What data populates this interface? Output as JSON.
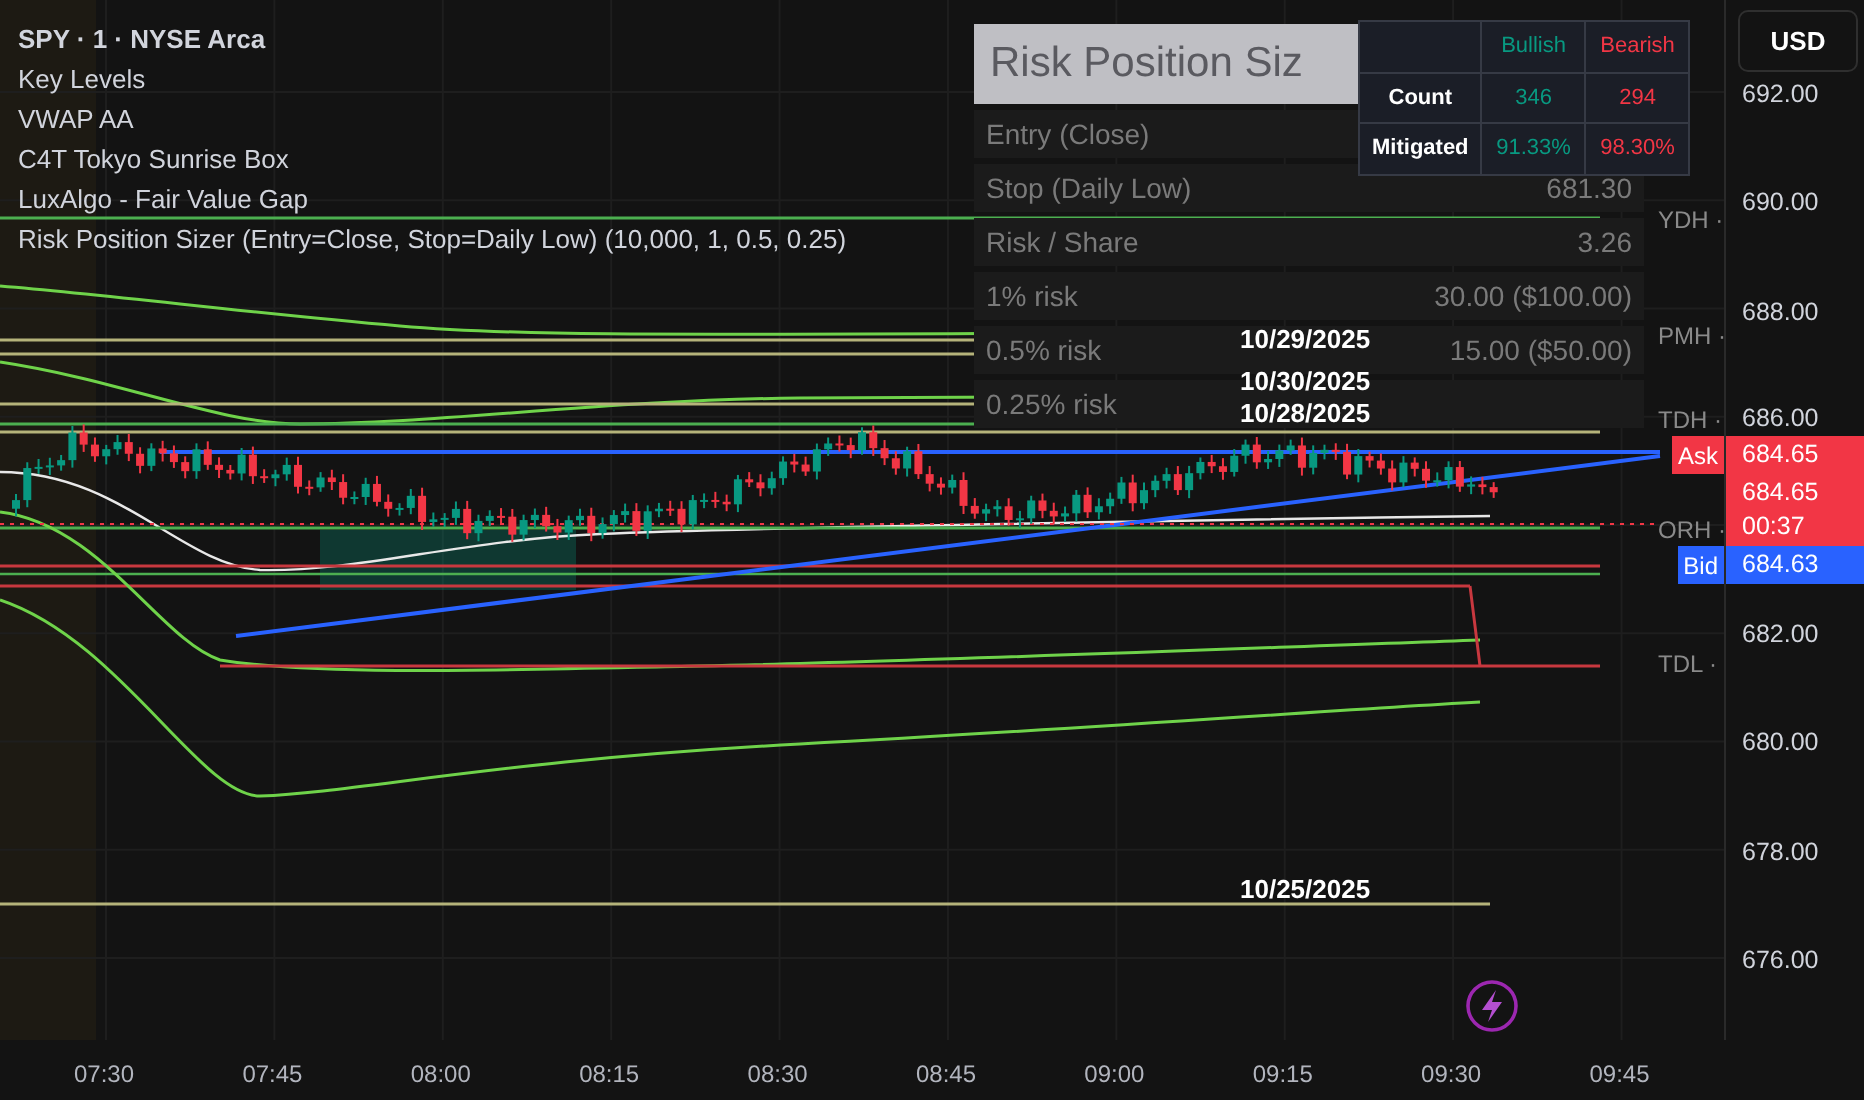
{
  "legend": [
    {
      "kind": "symbol",
      "text": "SPY · 1 · NYSE Arca"
    },
    {
      "kind": "indicator",
      "text": "Key Levels"
    },
    {
      "kind": "indicator",
      "text": "VWAP AA"
    },
    {
      "kind": "indicator",
      "text": "C4T Tokyo Sunrise Box"
    },
    {
      "kind": "indicator",
      "text": "LuxAlgo - Fair Value Gap"
    },
    {
      "kind": "indicator",
      "text": "Risk Position Sizer (Entry=Close, Stop=Daily Low) (10,000, 1, 0.5, 0.25)"
    }
  ],
  "risk_panel": {
    "title": "Risk Position Siz",
    "rows": [
      {
        "label": "Entry (Close)"
      },
      {
        "label": "Stop (Daily Low)",
        "value": "681.30"
      },
      {
        "label": "Risk / Share",
        "value": "3.26"
      },
      {
        "label": "1% risk",
        "value": "30.00 ($100.00)"
      },
      {
        "label": "0.5% risk",
        "value": "15.00 ($50.00)"
      },
      {
        "label": "0.25% risk"
      }
    ]
  },
  "fvg_table": {
    "columns": [
      {
        "label": "Bullish",
        "color": "#089981"
      },
      {
        "label": "Bearish",
        "color": "#f23645"
      }
    ],
    "rows": [
      {
        "label": "Count",
        "values": [
          "346",
          "294"
        ]
      },
      {
        "label": "Mitigated",
        "values": [
          "91.33%",
          "98.30%"
        ]
      }
    ]
  },
  "currency_button": "USD",
  "price_axis": [
    "692.00",
    "690.00",
    "688.00",
    "686.00",
    "682.00",
    "680.00",
    "678.00",
    "676.00"
  ],
  "level_labels": [
    "YDH ·",
    "PMH ·",
    "TDH ·",
    "ORH ·",
    "TDL ·"
  ],
  "date_labels": [
    "10/29/2025",
    "10/30/2025",
    "10/28/2025",
    "10/25/2025"
  ],
  "price_tags": [
    {
      "kind": "ask",
      "label": "Ask",
      "value": "684.65"
    },
    {
      "kind": "last",
      "value": "684.65",
      "countdown": "00:37"
    },
    {
      "kind": "bid",
      "label": "Bid",
      "value": "684.63"
    }
  ],
  "time_axis": [
    "07:30",
    "07:45",
    "08:00",
    "08:15",
    "08:30",
    "08:45",
    "09:00",
    "09:15",
    "09:30",
    "09:45"
  ]
}
